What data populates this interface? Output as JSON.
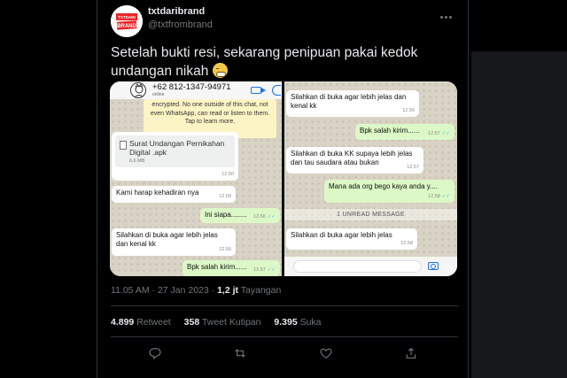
{
  "author": {
    "display_name": "txtdaribrand",
    "handle": "@txtfrombrand",
    "avatar_label": "TXTDARI BRAND"
  },
  "tweet": {
    "text": "Setelah bukti resi, sekarang penipuan pakai kedok undangan nikah",
    "emoji": "weary-face"
  },
  "media": {
    "left": {
      "contact_number": "+62 812-1347-94971",
      "status": "online",
      "encryption_notice": "encrypted. No one outside of this chat, not even WhatsApp, can read or listen to them. Tap to learn more.",
      "file": {
        "name": "Surat Undangan Pernikahan Digital .apk",
        "size": "6,6 MB",
        "time": "12.50"
      },
      "messages": [
        {
          "text": "Kami harap kehadiran nya",
          "time": "12.50",
          "outgoing": false
        },
        {
          "text": "Ini siapa........",
          "time": "12.56",
          "outgoing": true
        },
        {
          "text": "Silahkan di buka agar lebih jelas dan kenal kk",
          "time": "12.56",
          "outgoing": false
        },
        {
          "text": "Bpk salah kirim......",
          "time": "12.57",
          "outgoing": true
        }
      ]
    },
    "right": {
      "messages": [
        {
          "text": "Silahkan di buka agar lebih jelas dan kenal kk",
          "time": "12.56",
          "outgoing": false
        },
        {
          "text": "Bpk salah kirim......",
          "time": "12.57",
          "outgoing": true
        },
        {
          "text": "Silahkan di buka KK supaya lebih jelas dan tau saudara atau bukan",
          "time": "12.57",
          "outgoing": false
        },
        {
          "text": "Mana ada org bego kaya anda y....",
          "time": "12.58",
          "outgoing": true
        },
        {
          "text": "Silahkan di buka agar lebih jelas",
          "time": "12.58",
          "outgoing": false
        }
      ],
      "unread_label": "1 UNREAD MESSAGE"
    }
  },
  "meta": {
    "time": "11.05 AM",
    "date": "27 Jan 2023",
    "separator": " · ",
    "views": "1,2 jt",
    "views_label": "Tayangan"
  },
  "stats": {
    "retweets": "4.899",
    "retweets_label": "Retweet",
    "quotes": "358",
    "quotes_label": "Tweet Kutipan",
    "likes": "9.395",
    "likes_label": "Suka"
  },
  "actions": [
    "reply-icon",
    "retweet-icon",
    "like-icon",
    "share-icon"
  ],
  "colors": {
    "background": "#000000",
    "text": "#e7e9ea",
    "muted": "#71767b",
    "border": "#2f3336",
    "whatsapp_out": "#dcf8c6"
  }
}
